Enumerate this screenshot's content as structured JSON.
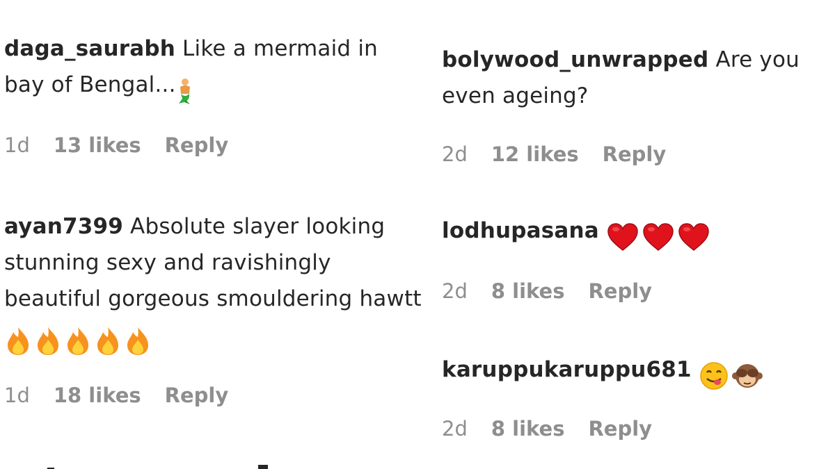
{
  "comments": [
    {
      "username": "daga_saurabh",
      "text": "Like a mermaid in bay of Bengal...",
      "emojis": [
        "mermaid-emoji"
      ],
      "time": "1d",
      "likes": "13 likes",
      "reply": "Reply"
    },
    {
      "username": "bolywood_unwrapped",
      "text": "Are you even ageing?",
      "emojis": [],
      "time": "2d",
      "likes": "12 likes",
      "reply": "Reply"
    },
    {
      "username": "ayan7399",
      "text": "Absolute slayer looking stunning sexy and ravishingly beautiful gorgeous smouldering hawtt",
      "emojis": [
        "fire-emoji",
        "fire-emoji",
        "fire-emoji",
        "fire-emoji",
        "fire-emoji"
      ],
      "time": "1d",
      "likes": "18 likes",
      "reply": "Reply"
    },
    {
      "username": "lodhupasana",
      "text": "",
      "emojis": [
        "heart-emoji",
        "heart-emoji",
        "heart-emoji"
      ],
      "time": "2d",
      "likes": "8 likes",
      "reply": "Reply"
    },
    {
      "username": "karuppukaruppu681",
      "text": "",
      "emojis": [
        "yum-face-emoji",
        "see-no-evil-monkey-emoji"
      ],
      "time": "2d",
      "likes": "8 likes",
      "reply": "Reply"
    }
  ],
  "colors": {
    "text": "#262626",
    "meta": "#8e8e8e",
    "heart": "#e0131d",
    "fire": "#f7921e"
  }
}
